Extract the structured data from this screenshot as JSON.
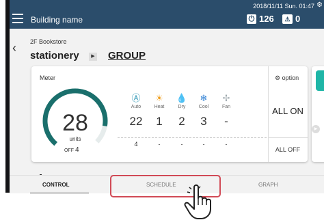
{
  "header": {
    "building_name": "Building name",
    "datetime": "2018/11/11 Sun. 01:47",
    "power_count": "126",
    "alert_count": "0",
    "power_icon": "power-icon",
    "alert_icon": "warning-icon",
    "menu_icon": "hamburger-menu-icon",
    "settings_icon": "gear-icon",
    "color": "#2b4d6b"
  },
  "breadcrumb": {
    "floor": "2F Bookstore",
    "location": "stationery",
    "group": "GROUP"
  },
  "meter": {
    "title": "Meter",
    "value": "28",
    "unit": "units",
    "off_label": "OFF",
    "off_count": "4",
    "accent_color": "#1a6f6c"
  },
  "modes": [
    {
      "label": "Auto",
      "count": "22",
      "off": "4",
      "icon": "auto-mode-icon",
      "color": "#1e8fb0"
    },
    {
      "label": "Heat",
      "count": "1",
      "off": "-",
      "icon": "sun-icon",
      "color": "#f0a020"
    },
    {
      "label": "Dry",
      "count": "2",
      "off": "-",
      "icon": "droplet-icon",
      "color": "#3a9ad9"
    },
    {
      "label": "Cool",
      "count": "3",
      "off": "-",
      "icon": "snowflake-icon",
      "color": "#2e7fd3"
    },
    {
      "label": "Fan",
      "count": "-",
      "off": "-",
      "icon": "fan-icon",
      "color": "#9aa5aa"
    }
  ],
  "options": {
    "option_label": "option",
    "all_on": "ALL ON",
    "all_off": "ALL OFF"
  },
  "tabs": {
    "control": "CONTROL",
    "schedule": "SCHEDULE",
    "graph": "GRAPH"
  },
  "callout": {
    "highlight_color": "#d14a56",
    "target": "SCHEDULE"
  }
}
